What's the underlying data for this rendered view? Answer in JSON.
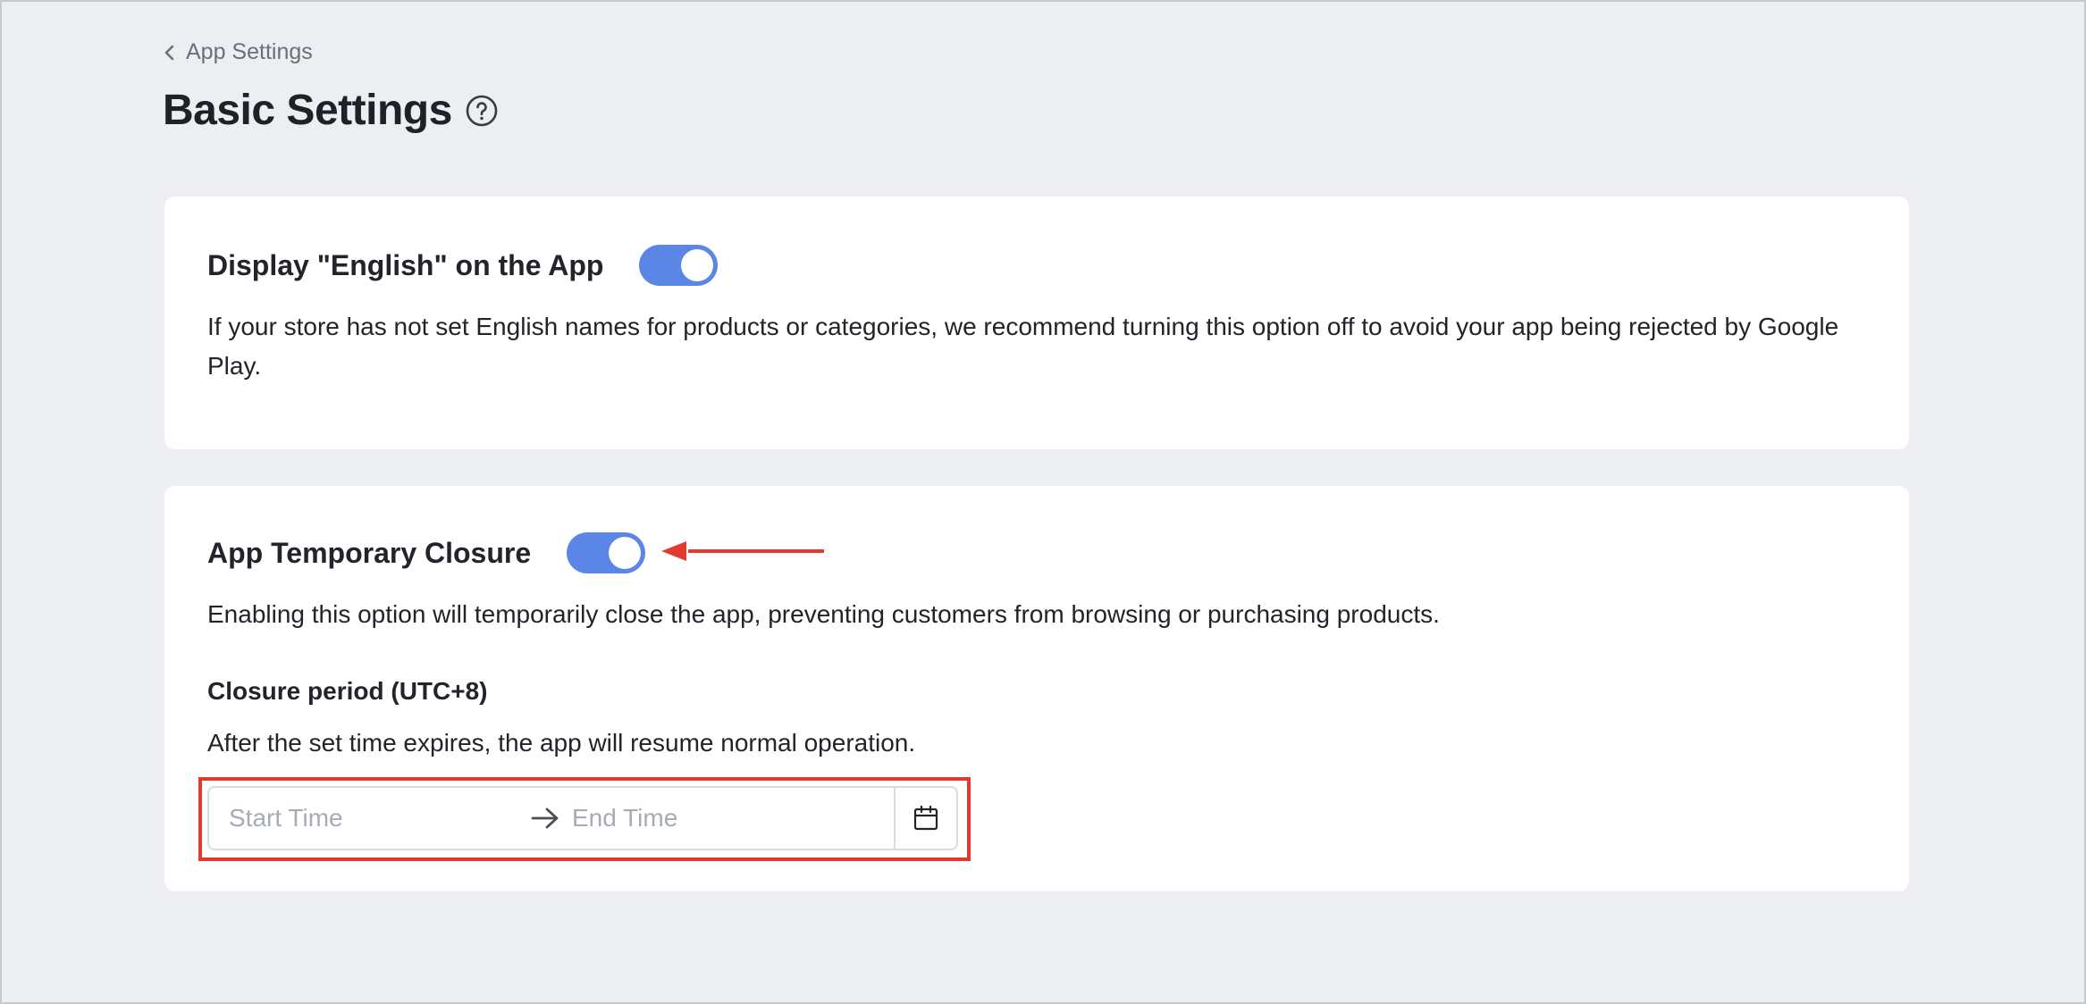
{
  "breadcrumb": {
    "label": "App Settings"
  },
  "page": {
    "title": "Basic Settings"
  },
  "english_card": {
    "title": "Display \"English\" on the App",
    "toggle_on": true,
    "description": "If your store has not set English names for products or categories, we recommend turning this option off to avoid your app being rejected by Google Play."
  },
  "closure_card": {
    "title": "App Temporary Closure",
    "toggle_on": true,
    "description": "Enabling this option will temporarily close the app, preventing customers from browsing or purchasing products.",
    "period_label": "Closure period (UTC+8)",
    "period_note": "After the set time expires, the app will resume normal operation.",
    "start_placeholder": "Start Time",
    "end_placeholder": "End Time"
  },
  "colors": {
    "accent": "#5b86e5",
    "annotation": "#e03b2e",
    "background": "#eceef2"
  },
  "icons": {
    "back": "chevron-left-icon",
    "help": "question-circle-icon",
    "range_separator": "arrow-right-icon",
    "calendar": "calendar-icon"
  }
}
